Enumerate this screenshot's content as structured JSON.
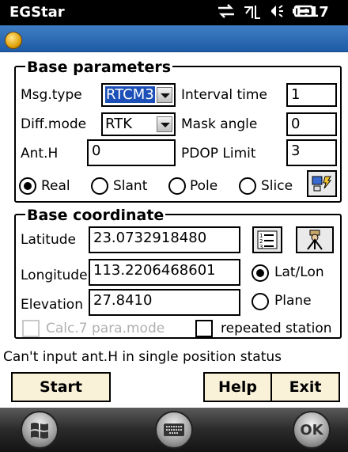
{
  "status_bar": {
    "app_title": "EGStar",
    "time": "1:17",
    "icons": [
      "network-sync-icon",
      "signal-off-icon",
      "volume-icon",
      "battery-icon"
    ]
  },
  "base_parameters": {
    "title": "Base parameters",
    "msg_type_label": "Msg.type",
    "msg_type_value": "RTCM3",
    "interval_time_label": "Interval time",
    "interval_time_value": "1",
    "diff_mode_label": "Diff.mode",
    "diff_mode_value": "RTK",
    "mask_angle_label": "Mask angle",
    "mask_angle_value": "0",
    "ant_h_label": "Ant.H",
    "ant_h_value": "0",
    "pdop_limit_label": "PDOP Limit",
    "pdop_limit_value": "3",
    "height_types": [
      {
        "label": "Real",
        "selected": true
      },
      {
        "label": "Slant",
        "selected": false
      },
      {
        "label": "Pole",
        "selected": false
      },
      {
        "label": "Slice",
        "selected": false
      }
    ]
  },
  "base_coordinate": {
    "title": "Base coordinate",
    "latitude_label": "Latitude",
    "latitude_value": "23.0732918480",
    "longitude_label": "Longitude",
    "longitude_value": "113.2206468601",
    "elevation_label": "Elevation",
    "elevation_value": "27.8410",
    "coord_types": [
      {
        "label": "Lat/Lon",
        "selected": true
      },
      {
        "label": "Plane",
        "selected": false
      }
    ],
    "calc_para_label": "Calc.7 para.mode",
    "repeated_station_label": "repeated station"
  },
  "status_message": "Can't input ant.H in single position status",
  "actions": {
    "start": "Start",
    "help": "Help",
    "exit": "Exit"
  },
  "taskbar": {
    "ok_label": "OK"
  },
  "colors": {
    "selection": "#1c50b8",
    "button_bg": "#faf2d8",
    "app_bar": "#2b6cb8"
  }
}
